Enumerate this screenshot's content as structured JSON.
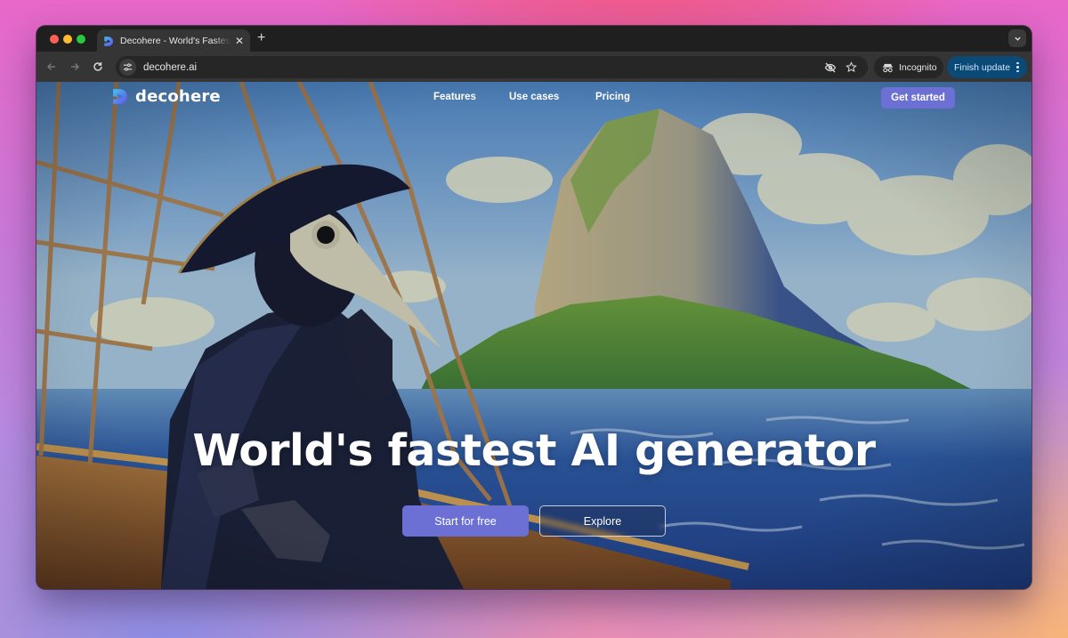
{
  "browser": {
    "tab": {
      "title": "Decohere - World's Fastest AI Generator",
      "favicon": "decohere-logo-icon"
    },
    "new_tab_label": "+",
    "address": {
      "url": "decohere.ai"
    },
    "incognito_label": "Incognito",
    "finish_update_label": "Finish update",
    "icons": {
      "back": "arrow-left-icon",
      "forward": "arrow-right-icon",
      "reload": "reload-icon",
      "site_info": "tune-icon",
      "tracking": "eye-off-icon",
      "bookmark": "star-icon",
      "incognito": "incognito-icon",
      "menu": "kebab-menu-icon",
      "tab_search": "chevron-down-icon",
      "close_tab": "close-icon"
    }
  },
  "site": {
    "brand": "decohere",
    "nav": [
      {
        "label": "Features"
      },
      {
        "label": "Use cases"
      },
      {
        "label": "Pricing"
      }
    ],
    "get_started_label": "Get started",
    "hero": {
      "title": "World's fastest AI generator",
      "primary_cta": "Start for free",
      "secondary_cta": "Explore"
    },
    "colors": {
      "accent": "#6c70d4",
      "update_button": "#0b4a77",
      "browser_chrome": "#1f1f1f",
      "toolbar": "#353535"
    }
  }
}
